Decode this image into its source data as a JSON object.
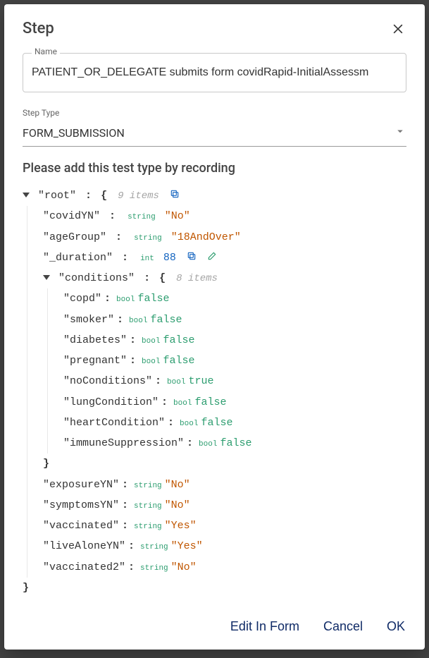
{
  "dialog": {
    "title": "Step",
    "nameField": {
      "label": "Name",
      "value": "PATIENT_OR_DELEGATE submits form covidRapid-InitialAssessm"
    },
    "stepType": {
      "label": "Step Type",
      "value": "FORM_SUBMISSION"
    },
    "instruction": "Please add this test type by recording",
    "footer": {
      "editInForm": "Edit In Form",
      "cancel": "Cancel",
      "ok": "OK"
    }
  },
  "jsonTree": {
    "rootKey": "\"root\"",
    "rootBrace": "{",
    "rootItems": "9 items",
    "closeBrace": "}",
    "fields": {
      "covidYN": {
        "key": "\"covidYN\"",
        "type": "string",
        "value": "\"No\""
      },
      "ageGroup": {
        "key": "\"ageGroup\"",
        "type": "string",
        "value": "\"18AndOver\""
      },
      "duration": {
        "key": "\"_duration\"",
        "type": "int",
        "value": "88"
      },
      "conditionsKey": {
        "key": "\"conditions\"",
        "brace": "{",
        "items": "8 items"
      },
      "exposureYN": {
        "key": "\"exposureYN\"",
        "type": "string",
        "value": "\"No\""
      },
      "symptomsYN": {
        "key": "\"symptomsYN\"",
        "type": "string",
        "value": "\"No\""
      },
      "vaccinated": {
        "key": "\"vaccinated\"",
        "type": "string",
        "value": "\"Yes\""
      },
      "liveAloneYN": {
        "key": "\"liveAloneYN\"",
        "type": "string",
        "value": "\"Yes\""
      },
      "vaccinated2": {
        "key": "\"vaccinated2\"",
        "type": "string",
        "value": "\"No\""
      }
    },
    "conditions": {
      "copd": {
        "key": "\"copd\"",
        "type": "bool",
        "value": "false"
      },
      "smoker": {
        "key": "\"smoker\"",
        "type": "bool",
        "value": "false"
      },
      "diabetes": {
        "key": "\"diabetes\"",
        "type": "bool",
        "value": "false"
      },
      "pregnant": {
        "key": "\"pregnant\"",
        "type": "bool",
        "value": "false"
      },
      "noConditions": {
        "key": "\"noConditions\"",
        "type": "bool",
        "value": "true"
      },
      "lungCondition": {
        "key": "\"lungCondition\"",
        "type": "bool",
        "value": "false"
      },
      "heartCondition": {
        "key": "\"heartCondition\"",
        "type": "bool",
        "value": "false"
      },
      "immuneSuppression": {
        "key": "\"immuneSuppression\"",
        "type": "bool",
        "value": "false"
      }
    }
  }
}
